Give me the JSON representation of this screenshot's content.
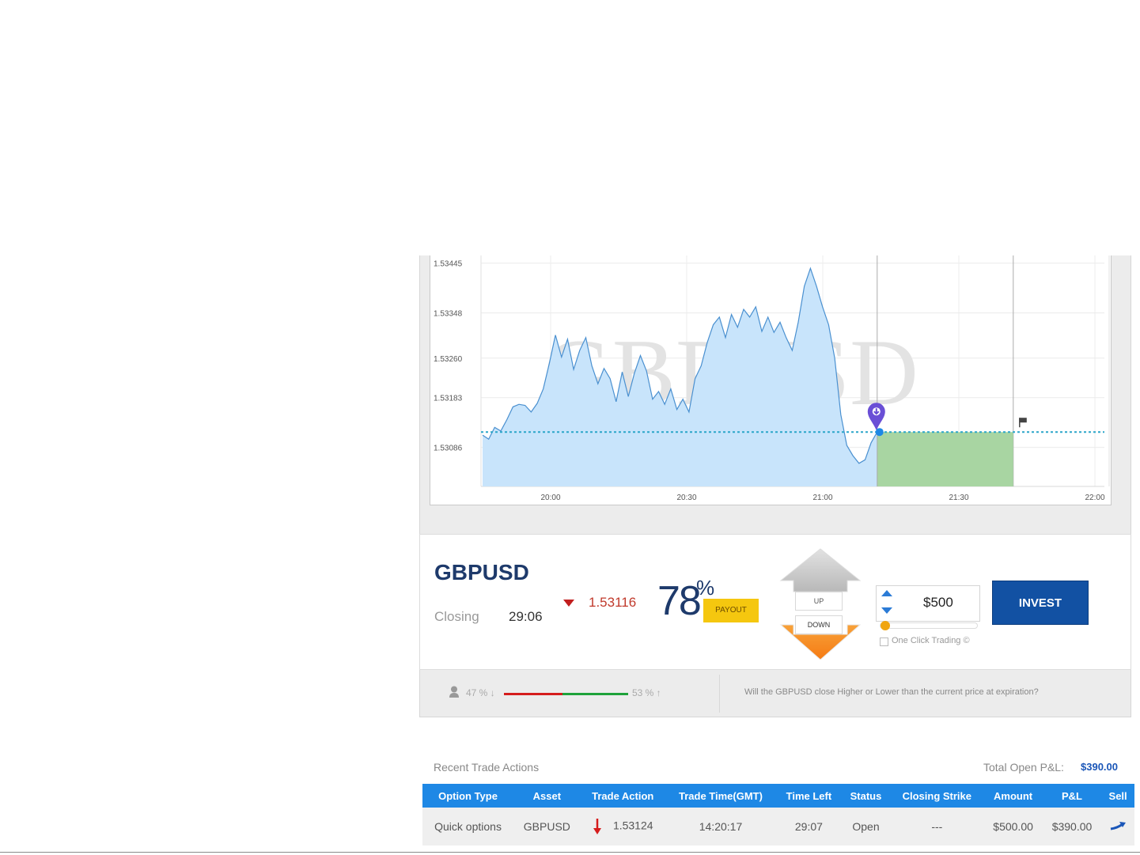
{
  "chart": {
    "watermark": "GBPUSD",
    "y_ticks": [
      "1.53445",
      "1.53348",
      "1.53260",
      "1.53183",
      "1.53086"
    ],
    "x_ticks": [
      "20:00",
      "20:30",
      "21:00",
      "21:30",
      "22:00"
    ]
  },
  "chart_data": {
    "type": "area",
    "series": [
      {
        "values": [
          1.5311,
          1.53102,
          1.53125,
          1.53118,
          1.5314,
          1.53165,
          1.5317,
          1.53168,
          1.53155,
          1.53172,
          1.532,
          1.5325,
          1.53305,
          1.53262,
          1.53297,
          1.53238,
          1.53275,
          1.533,
          1.53245,
          1.5321,
          1.5324,
          1.5322,
          1.53175,
          1.53233,
          1.53185,
          1.5323,
          1.53265,
          1.53235,
          1.5318,
          1.53195,
          1.5317,
          1.532,
          1.5316,
          1.5318,
          1.53155,
          1.5322,
          1.53245,
          1.5329,
          1.53325,
          1.5334,
          1.533,
          1.53345,
          1.5332,
          1.53355,
          1.5334,
          1.5336,
          1.53312,
          1.5334,
          1.5331,
          1.5333,
          1.533,
          1.53275,
          1.5333,
          1.534,
          1.53435,
          1.534,
          1.5336,
          1.53325,
          1.5326,
          1.5315,
          1.5309,
          1.5307,
          1.53055,
          1.53062,
          1.53095,
          1.53116
        ]
      }
    ],
    "ylim": [
      1.5301,
      1.5346
    ],
    "strike": 1.53116,
    "entry_time": "21:12",
    "expiry_time": "21:42"
  },
  "asset": {
    "name": "GBPUSD",
    "closing_label": "Closing",
    "closing_timer": "29:06",
    "price": "1.53116",
    "payout_value": "78",
    "payout_percent": "%",
    "payout_label": "PAYOUT"
  },
  "controls": {
    "up_label": "UP",
    "down_label": "DOWN",
    "amount": "$500",
    "one_click_label": "One Click Trading ©",
    "invest_label": "INVEST",
    "slider_level": 0.0
  },
  "sentiment": {
    "down_pct": "47 % ↓",
    "up_pct": "53 % ↑",
    "down_fraction": 0.47,
    "question": "Will the GBPUSD close Higher or Lower than the current price at expiration?"
  },
  "recent": {
    "title": "Recent Trade Actions",
    "pnl_label": "Total Open P&L:",
    "pnl_value": "$390.00",
    "columns": [
      "Option Type",
      "Asset",
      "Trade Action",
      "Trade Time(GMT)",
      "Time Left",
      "Status",
      "Closing Strike",
      "Amount",
      "P&L",
      "Sell"
    ],
    "rows": [
      {
        "option_type": "Quick options",
        "asset": "GBPUSD",
        "trade_action": "1.53124",
        "trade_time": "14:20:17",
        "time_left": "29:07",
        "status": "Open",
        "closing_strike": "---",
        "amount": "$500.00",
        "pnl": "$390.00"
      }
    ]
  },
  "colors": {
    "brand": "#1e3a6b",
    "invest": "#1251a3",
    "header": "#1e88e5",
    "area_fill": "#c8e4fb",
    "area_line": "#4a90d0",
    "profit_zone": "#a8d5a2",
    "down_red": "#d51c1c",
    "up_green": "#1ea23a"
  }
}
